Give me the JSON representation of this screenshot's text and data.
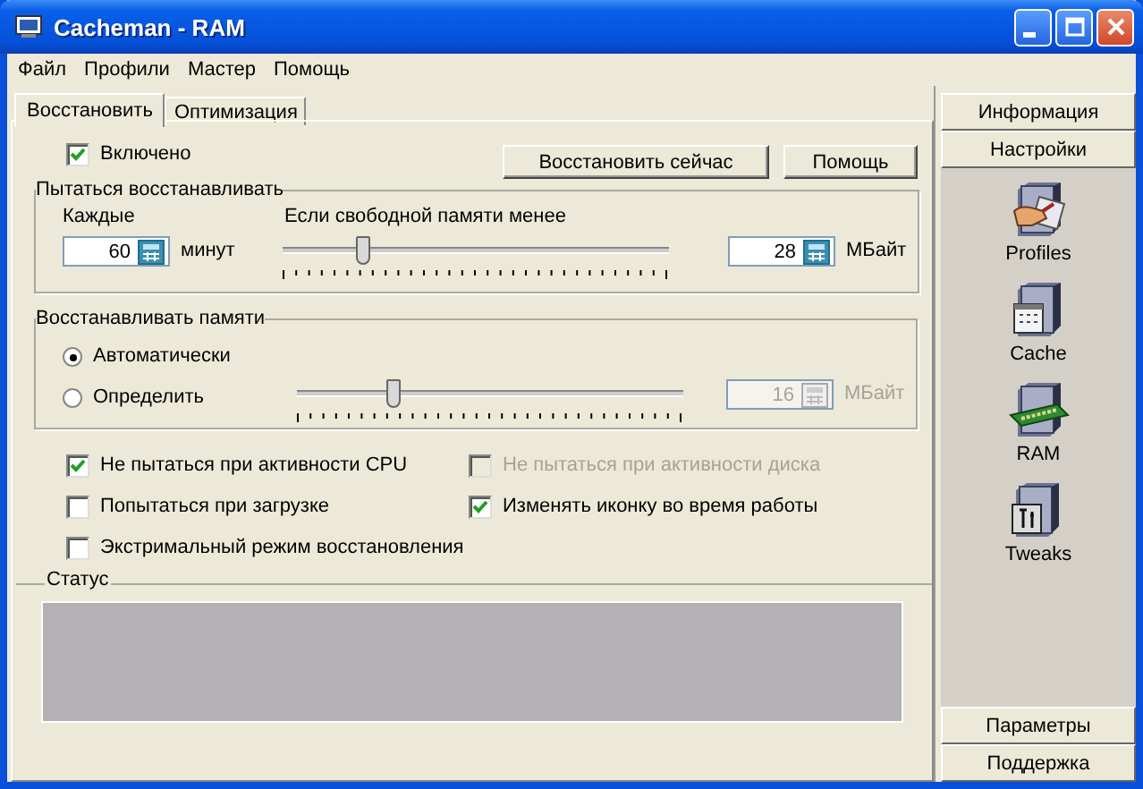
{
  "window": {
    "title": "Cacheman - RAM"
  },
  "menu": [
    "Файл",
    "Профили",
    "Мастер",
    "Помощь"
  ],
  "tabs": [
    {
      "label": "Восстановить",
      "selected": true
    },
    {
      "label": "Оптимизация",
      "selected": false
    }
  ],
  "enabled": {
    "label": "Включено",
    "checked": true
  },
  "buttons": [
    "Восстановить сейчас",
    "Помощь"
  ],
  "retry_group": {
    "title": "Пытаться восстанавливать",
    "every_label": "Каждые",
    "minutes": {
      "value": "60",
      "disabled": false
    },
    "minutes_unit": "минут",
    "threshold_label": "Если свободной памяти менее",
    "slider": {
      "level": 0.21
    },
    "megabytes": {
      "value": "28",
      "disabled": false
    },
    "megabytes_unit": "МБайт"
  },
  "amount_group": {
    "title": "Восстанавливать памяти",
    "radios": [
      {
        "label": "Автоматически",
        "selected": true
      },
      {
        "label": "Определить",
        "selected": false
      }
    ],
    "slider": {
      "level": 0.25
    },
    "megabytes": {
      "value": "16",
      "disabled": true
    },
    "megabytes_unit": "МБайт"
  },
  "options": [
    {
      "label": "Не пытаться при активности CPU",
      "checked": true,
      "disabled": false
    },
    {
      "label": "Не пытаться при активности диска",
      "checked": false,
      "disabled": true
    },
    {
      "label": "Попытаться при загрузке",
      "checked": false,
      "disabled": false
    },
    {
      "label": "Изменять иконку во время работы",
      "checked": true,
      "disabled": false
    },
    {
      "label": "Экстримальный режим восстановления",
      "checked": false,
      "disabled": false
    }
  ],
  "status": {
    "title": "Статус"
  },
  "sidebar": {
    "top_sections": [
      "Информация",
      "Настройки"
    ],
    "items": [
      {
        "label": "Profiles",
        "kind": "profiles"
      },
      {
        "label": "Cache",
        "kind": "cache"
      },
      {
        "label": "RAM",
        "kind": "ram"
      },
      {
        "label": "Tweaks",
        "kind": "tweaks"
      }
    ],
    "bottom_sections": [
      "Параметры",
      "Поддержка"
    ]
  }
}
